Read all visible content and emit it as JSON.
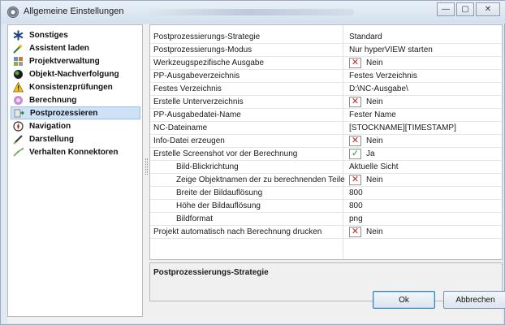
{
  "window": {
    "title": "Allgemeine Einstellungen"
  },
  "nav": {
    "items": [
      {
        "label": "Sonstiges",
        "icon": "asterisk-icon"
      },
      {
        "label": "Assistent laden",
        "icon": "wand-icon"
      },
      {
        "label": "Projektverwaltung",
        "icon": "project-icon"
      },
      {
        "label": "Objekt-Nachverfolgung",
        "icon": "tracking-ball-icon"
      },
      {
        "label": "Konsistenzprüfungen",
        "icon": "warning-icon"
      },
      {
        "label": "Berechnung",
        "icon": "calculation-icon"
      },
      {
        "label": "Postprozessieren",
        "icon": "postprocess-icon"
      },
      {
        "label": "Navigation",
        "icon": "compass-icon"
      },
      {
        "label": "Darstellung",
        "icon": "pen-icon"
      },
      {
        "label": "Verhalten Konnektoren",
        "icon": "connector-icon"
      }
    ],
    "active": "Postprozessieren"
  },
  "properties": [
    {
      "name": "Postprozessierungs-Strategie",
      "value": "Standard"
    },
    {
      "name": "Postprozessierungs-Modus",
      "value": "Nur hyperVIEW starten"
    },
    {
      "name": "Werkzeugspezifische Ausgabe",
      "value": "Nein",
      "check": "no"
    },
    {
      "name": "PP-Ausgabeverzeichnis",
      "value": "Festes Verzeichnis"
    },
    {
      "name": "Festes Verzeichnis",
      "value": "D:\\NC-Ausgabe\\"
    },
    {
      "name": "Erstelle Unterverzeichnis",
      "value": "Nein",
      "check": "no"
    },
    {
      "name": "PP-Ausgabedatei-Name",
      "value": "Fester Name"
    },
    {
      "name": "NC-Dateiname",
      "value": "[STOCKNAME][TIMESTAMP]"
    },
    {
      "name": "Info-Datei erzeugen",
      "value": "Nein",
      "check": "no"
    },
    {
      "name": "Erstelle Screenshot vor der Berechnung",
      "value": "Ja",
      "check": "yes"
    },
    {
      "name": "Bild-Blickrichtung",
      "value": "Aktuelle Sicht",
      "sub": true
    },
    {
      "name": "Zeige Objektnamen der zu berechnenden Teile",
      "value": "Nein",
      "check": "no",
      "sub": true
    },
    {
      "name": "Breite der Bildauflösung",
      "value": "800",
      "sub": true
    },
    {
      "name": "Höhe der Bildauflösung",
      "value": "800",
      "sub": true
    },
    {
      "name": "Bildformat",
      "value": "png",
      "sub": true
    },
    {
      "name": "Projekt automatisch nach Berechnung drucken",
      "value": "Nein",
      "check": "no"
    }
  ],
  "description": {
    "title": "Postprozessierungs-Strategie"
  },
  "buttons": {
    "ok": "Ok",
    "cancel": "Abbrechen"
  },
  "caption_buttons": {
    "minimize": "—",
    "maximize": "▢",
    "close": "✕"
  },
  "glyphs": {
    "no": "✕",
    "yes": "✓"
  },
  "colors": {
    "selection": "#cde1f7",
    "check_no": "#d62020",
    "check_yes": "#1e9a2e"
  }
}
